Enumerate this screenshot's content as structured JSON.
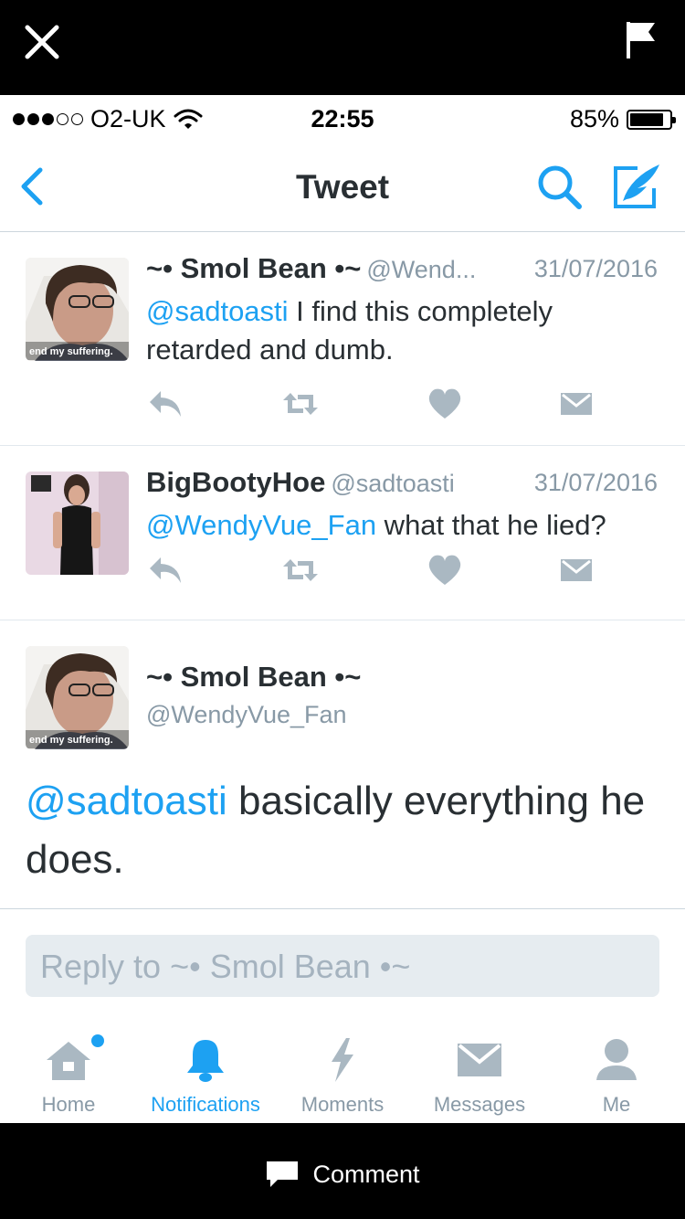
{
  "status_bar": {
    "carrier": "O2-UK",
    "signal_bars_filled": 3,
    "signal_bars_total": 5,
    "time": "22:55",
    "battery_percent": "85%",
    "battery_level": 0.85
  },
  "nav": {
    "title": "Tweet",
    "back_icon": "chevron-left-icon",
    "search_icon": "search-icon",
    "compose_icon": "compose-tweet-icon"
  },
  "tweets": [
    {
      "name": "~• Smol Bean •~",
      "handle": "@Wend...",
      "date": "31/07/2016",
      "mention": "@sadtoasti",
      "text": " I find this completely retarded and dumb.",
      "avatar_caption": "end my suffering."
    },
    {
      "name": "BigBootyHoe",
      "handle": "@sadtoasti",
      "date": "31/07/2016",
      "mention": "@WendyVue_Fan",
      "text": " what that he lied?"
    }
  ],
  "focused_tweet": {
    "name": "~• Smol Bean •~",
    "handle": "@WendyVue_Fan",
    "mention": "@sadtoasti",
    "text": " basically everything he does.",
    "avatar_caption": "end my suffering."
  },
  "reply_box": {
    "placeholder": "Reply to ~• Smol Bean •~"
  },
  "tabs": [
    {
      "label": "Home",
      "icon": "home-icon",
      "active": false,
      "badge": true
    },
    {
      "label": "Notifications",
      "icon": "bell-icon",
      "active": true
    },
    {
      "label": "Moments",
      "icon": "lightning-icon",
      "active": false
    },
    {
      "label": "Messages",
      "icon": "envelope-icon",
      "active": false
    },
    {
      "label": "Me",
      "icon": "person-icon",
      "active": false
    }
  ],
  "comment_bar": {
    "label": "Comment",
    "icon": "speech-bubble-icon"
  },
  "colors": {
    "accent": "#1da1f2",
    "text": "#292f33",
    "secondary": "#8899a6",
    "action_icon": "#aab8c2"
  }
}
